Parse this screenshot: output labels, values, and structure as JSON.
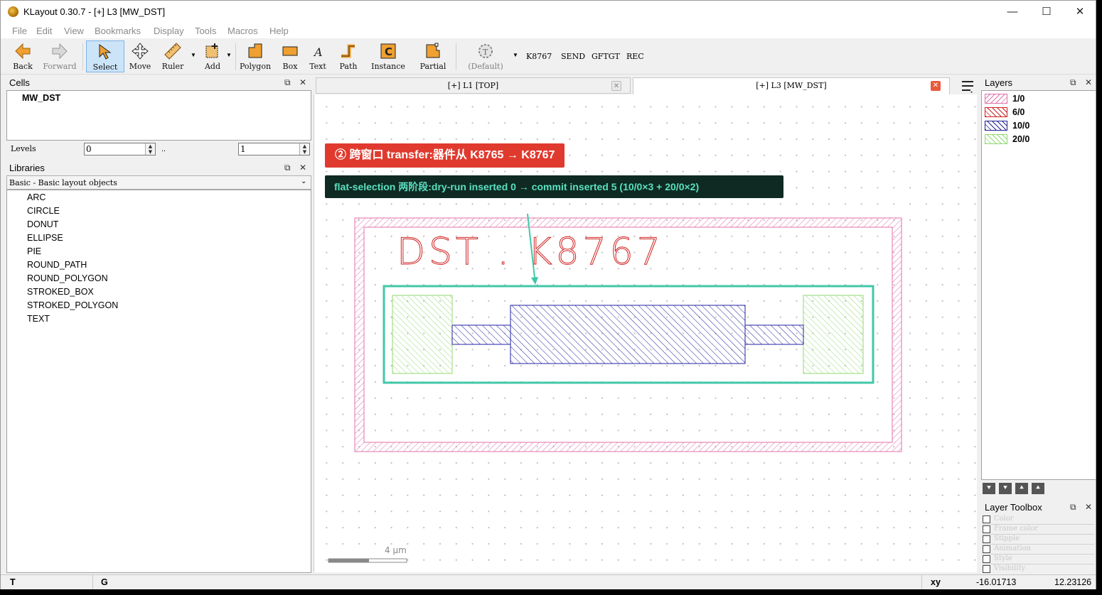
{
  "window": {
    "title": "KLayout 0.30.7 - [+] L3 [MW_DST]",
    "controls": {
      "minimize": "—",
      "maximize": "☐",
      "close": "✕"
    }
  },
  "menu": [
    "File",
    "Edit",
    "View",
    "Bookmarks",
    "Display",
    "Tools",
    "Macros",
    "Help"
  ],
  "toolbar": {
    "back": "Back",
    "forward": "Forward",
    "select": "Select",
    "move": "Move",
    "ruler": "Ruler",
    "add": "Add",
    "polygon": "Polygon",
    "box": "Box",
    "text": "Text",
    "path": "Path",
    "instance": "Instance",
    "partial": "Partial",
    "default": "(Default)",
    "macros": [
      "K8767",
      "SEND",
      "GFTGT",
      "REC"
    ]
  },
  "cells": {
    "title": "Cells",
    "items": [
      "MW_DST"
    ],
    "levels_label": "Levels",
    "level_from": "0",
    "level_sep": "..",
    "level_to": "1"
  },
  "libraries": {
    "title": "Libraries",
    "selected": "Basic - Basic layout objects",
    "items": [
      "ARC",
      "CIRCLE",
      "DONUT",
      "ELLIPSE",
      "PIE",
      "ROUND_PATH",
      "ROUND_POLYGON",
      "STROKED_BOX",
      "STROKED_POLYGON",
      "TEXT"
    ]
  },
  "tabs": [
    {
      "label": "[+] L1 [TOP]",
      "active": false
    },
    {
      "label": "[+] L3 [MW_DST]",
      "active": true
    }
  ],
  "canvas": {
    "annotation_red": "② 跨窗口 transfer:器件从 K8765 → K8767",
    "annotation_dark": "flat-selection 两阶段:dry-run inserted 0 → commit inserted 5 (10/0×3 + 20/0×2)",
    "layout_text": "DST . K8767",
    "scale_label": "4 µm",
    "colors": {
      "layer_1_0": "#e060a0",
      "layer_6_0": "#d02020",
      "layer_10_0": "#2020a0",
      "layer_20_0": "#8ed070",
      "highlight": "#40c8a8"
    }
  },
  "layers": {
    "title": "Layers",
    "items": [
      {
        "name": "1/0",
        "color": "#e070a8"
      },
      {
        "name": "6/0",
        "color": "#d02020"
      },
      {
        "name": "10/0",
        "color": "#202090"
      },
      {
        "name": "20/0",
        "color": "#90d870"
      }
    ]
  },
  "layer_toolbox": {
    "title": "Layer Toolbox",
    "rows": [
      "Color",
      "Frame color",
      "Stipple",
      "Animation",
      "Style",
      "Visibility"
    ]
  },
  "status": {
    "left1": "T",
    "left2": "G",
    "coord_label": "xy",
    "x": "-16.01713",
    "y": "12.23126"
  }
}
